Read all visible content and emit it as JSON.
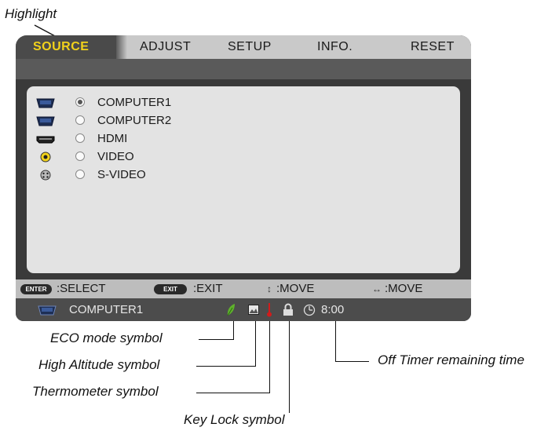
{
  "callouts": {
    "highlight": "Highlight",
    "eco": "ECO mode symbol",
    "altitude": "High Altitude symbol",
    "thermo": "Thermometer symbol",
    "keylock": "Key Lock symbol",
    "offtimer": "Off Timer remaining time"
  },
  "tabs": [
    "SOURCE",
    "ADJUST",
    "SETUP",
    "INFO.",
    "RESET"
  ],
  "sources": [
    {
      "label": "COMPUTER1",
      "icon": "vga-connector-icon",
      "selected": true
    },
    {
      "label": "COMPUTER2",
      "icon": "vga-connector-icon",
      "selected": false
    },
    {
      "label": "HDMI",
      "icon": "hdmi-connector-icon",
      "selected": false
    },
    {
      "label": "VIDEO",
      "icon": "rca-video-icon",
      "selected": false
    },
    {
      "label": "S-VIDEO",
      "icon": "s-video-icon",
      "selected": false
    }
  ],
  "help": {
    "enter_key": "ENTER",
    "select": ":SELECT",
    "exit_key": "EXIT",
    "exit": ":EXIT",
    "move_v_glyph": "↕",
    "move_v": ":MOVE",
    "move_h_glyph": "↔",
    "move_h": ":MOVE"
  },
  "status": {
    "source": "COMPUTER1",
    "timer": "8:00"
  },
  "colors": {
    "highlight": "#f2d21b",
    "eco": "#5fb22c",
    "thermo": "#d21b1b"
  }
}
